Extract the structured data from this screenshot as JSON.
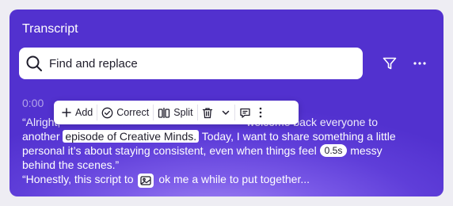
{
  "panel": {
    "title": "Transcript"
  },
  "search": {
    "placeholder": "Find and replace",
    "icon": "search-icon"
  },
  "header_actions": {
    "filter_icon": "filter-icon",
    "more_icon": "more-horizontal-icon"
  },
  "transcript": {
    "timestamp": "0:00",
    "line1_start": "“Alright,",
    "line1_end": "welcome back everyone to",
    "line2_before": "another",
    "line2_highlight": "episode of Creative Minds.",
    "line2_after": "Today, I want to share something a little",
    "line3_before": "personal it’s about staying consistent, even when things feel",
    "line3_pill": "0.5s",
    "line3_after": "messy",
    "line4": "behind the scenes.”",
    "line5_before": "“Honestly, this script to",
    "line5_after": "ok me a while to put together..."
  },
  "toolbar": {
    "add_label": "Add",
    "correct_label": "Correct",
    "split_label": "Split"
  },
  "colors": {
    "panel_bg": "#5f3ed9",
    "panel_glow": "#a58af4",
    "text_dark": "#1f1d2b"
  }
}
